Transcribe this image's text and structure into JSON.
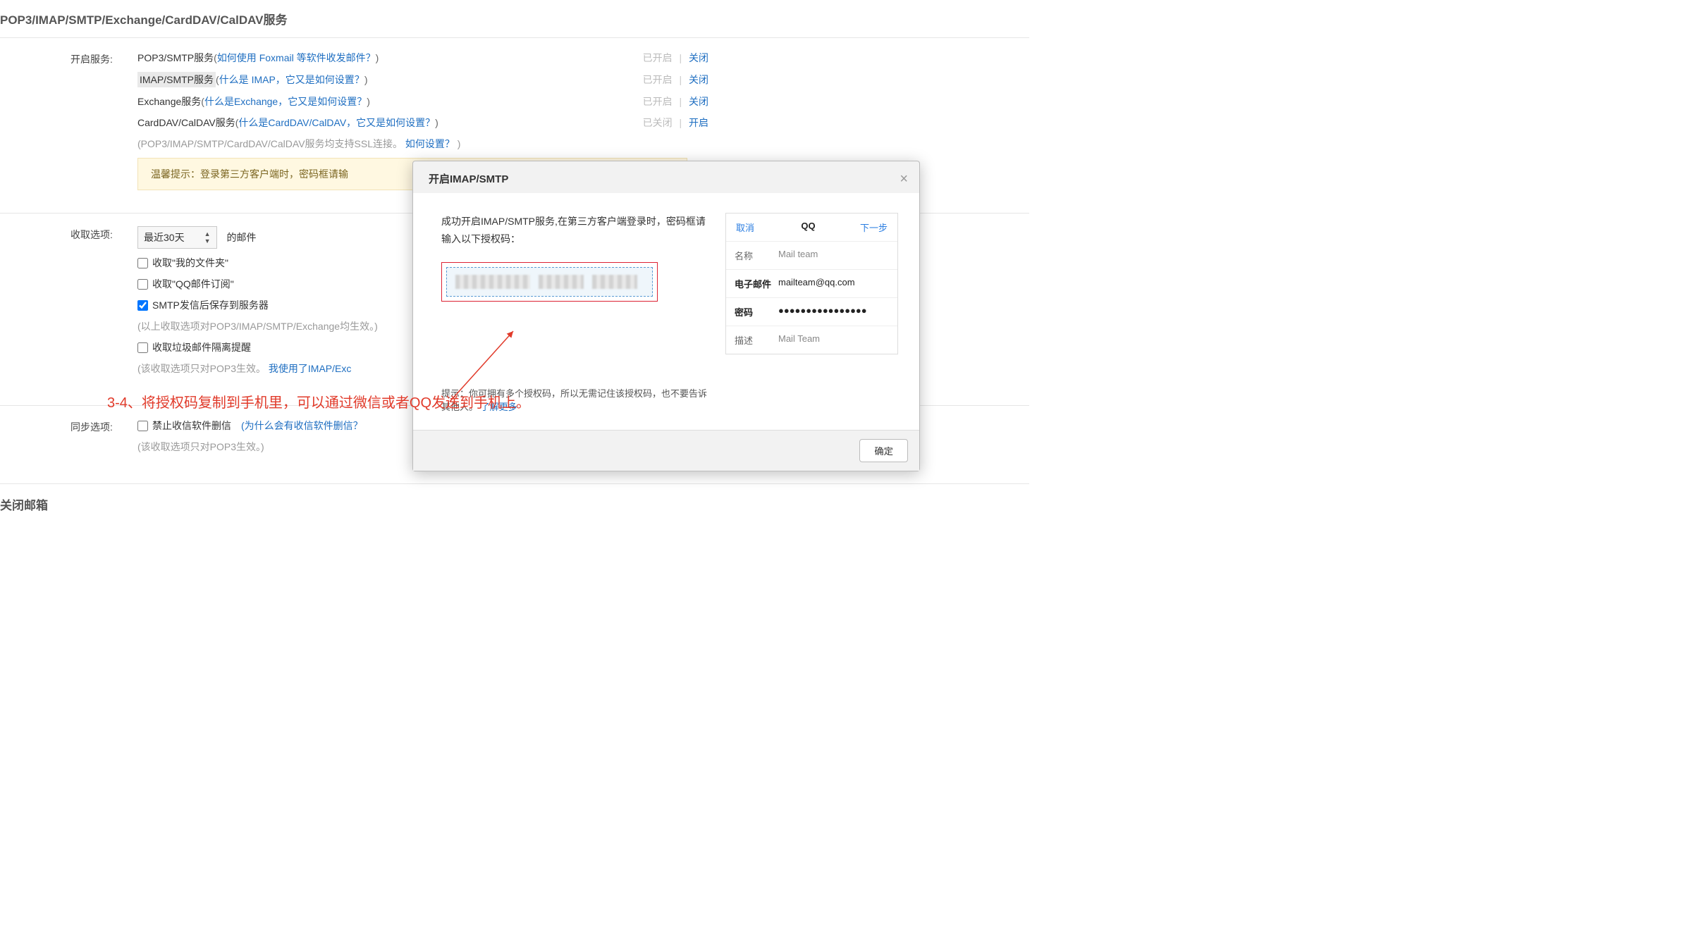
{
  "section_title": "POP3/IMAP/SMTP/Exchange/CardDAV/CalDAV服务",
  "labels": {
    "open_services": "开启服务:",
    "receive_options": "收取选项:",
    "sync_options": "同步选项:"
  },
  "services": {
    "pop3": {
      "name": "POP3/SMTP服务",
      "help": "如何使用 Foxmail 等软件收发邮件？",
      "status": "已开启",
      "action": "关闭"
    },
    "imap": {
      "name": "IMAP/SMTP服务",
      "help": "什么是 IMAP，它又是如何设置？",
      "status": "已开启",
      "action": "关闭"
    },
    "exchange": {
      "name": "Exchange服务",
      "help": "什么是Exchange，它又是如何设置？",
      "status": "已开启",
      "action": "关闭"
    },
    "carddav": {
      "name": "CardDAV/CalDAV服务",
      "help": "什么是CardDAV/CalDAV，它又是如何设置？",
      "status": "已关闭",
      "action": "开启"
    }
  },
  "ssl_note_prefix": "(POP3/IMAP/SMTP/CardDAV/CalDAV服务均支持SSL连接。",
  "ssl_note_link": "如何设置？",
  "ssl_note_suffix": ")",
  "warm_tip": "温馨提示：登录第三方客户端时，密码框请输",
  "receive": {
    "select_value": "最近30天",
    "suffix": "的邮件",
    "opt1": "收取\"我的文件夹\"",
    "opt2": "收取\"QQ邮件订阅\"",
    "opt3": "SMTP发信后保存到服务器",
    "hint1": "(以上收取选项对POP3/IMAP/SMTP/Exchange均生效。)",
    "opt4": "收取垃圾邮件隔离提醒",
    "hint2_prefix": "(该收取选项只对POP3生效。",
    "hint2_link": "我使用了IMAP/Exc",
    "hint2_suffix": ")"
  },
  "sync": {
    "opt1": "禁止收信软件删信",
    "help": "(为什么会有收信软件删信？",
    "hint": "(该收取选项只对POP3生效。)"
  },
  "close_mailbox_title": "关闭邮箱",
  "dialog": {
    "title": "开启IMAP/SMTP",
    "body_line": "成功开启IMAP/SMTP服务,在第三方客户端登录时，密码框请输入以下授权码：",
    "tip_prefix": "提示：你可拥有多个授权码，所以无需记住该授权码，也不要告诉其他人。",
    "tip_link": "了解更多",
    "ok": "确定",
    "phone": {
      "cancel": "取消",
      "title": "QQ",
      "next": "下一步",
      "rows": {
        "name_key": "名称",
        "name_val": "Mail team",
        "email_key": "电子邮件",
        "email_val": "mailteam@qq.com",
        "pwd_key": "密码",
        "pwd_val": "●●●●●●●●●●●●●●●●",
        "desc_key": "描述",
        "desc_val": "Mail Team"
      }
    }
  },
  "annotation": "3-4、将授权码复制到手机里，可以通过微信或者QQ发送到手机上。"
}
